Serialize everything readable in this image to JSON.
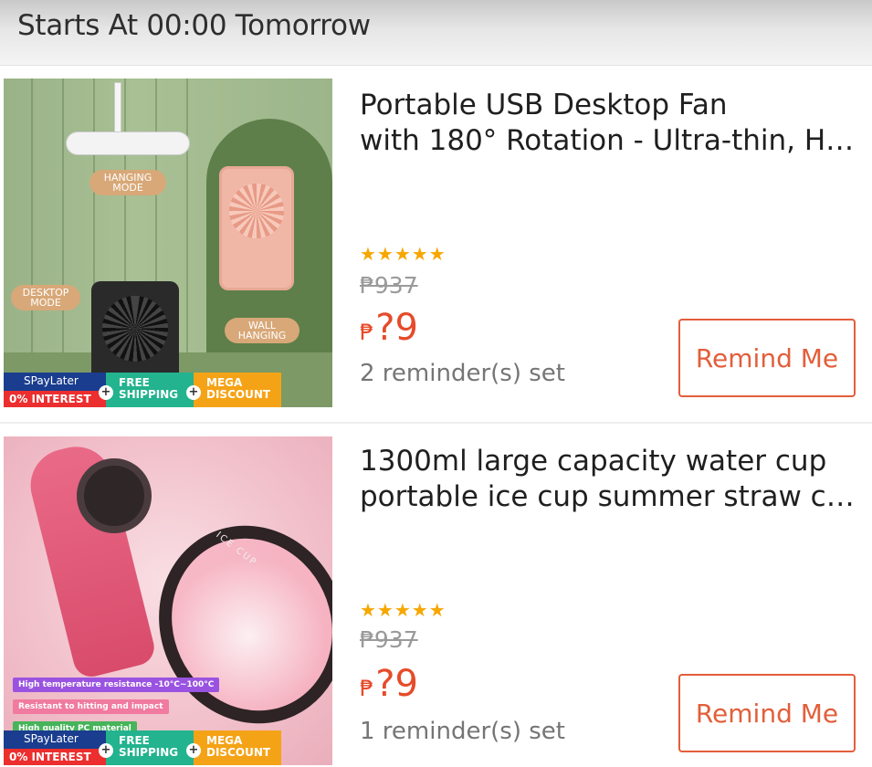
{
  "header": {
    "title": "Starts At 00:00 Tomorrow"
  },
  "products": [
    {
      "title_line1": "Portable USB Desktop Fan",
      "title_line2": "with 180° Rotation - Ultra-thin, H…",
      "rating_stars": "★★★★★",
      "currency": "₱",
      "original_price": "937",
      "sale_price": "?9",
      "reminders": "2 reminder(s) set",
      "button_label": "Remind Me",
      "image_tags": {
        "hanging": "HANGING MODE",
        "desktop": "DESKTOP MODE",
        "wall": "WALL HANGING"
      }
    },
    {
      "title_line1": "1300ml large capacity water cup",
      "title_line2": "portable ice cup summer straw c…",
      "rating_stars": "★★★★★",
      "currency": "₱",
      "original_price": "937",
      "sale_price": "?9",
      "reminders": "1 reminder(s) set",
      "button_label": "Remind Me",
      "image_tags": {
        "cup_text": "ICE CUP",
        "feature1": "High temperature resistance -10°C~100°C",
        "feature2": "Resistant to hitting and impact",
        "feature3": "High quality PC material"
      }
    }
  ],
  "banner": {
    "spaylater": "SPayLater",
    "interest": "0% INTEREST",
    "free_shipping": "FREE SHIPPING",
    "mega_discount": "MEGA DISCOUNT"
  },
  "colors": {
    "accent": "#e35e3a",
    "price": "#e64b2a",
    "star": "#f6a700"
  }
}
